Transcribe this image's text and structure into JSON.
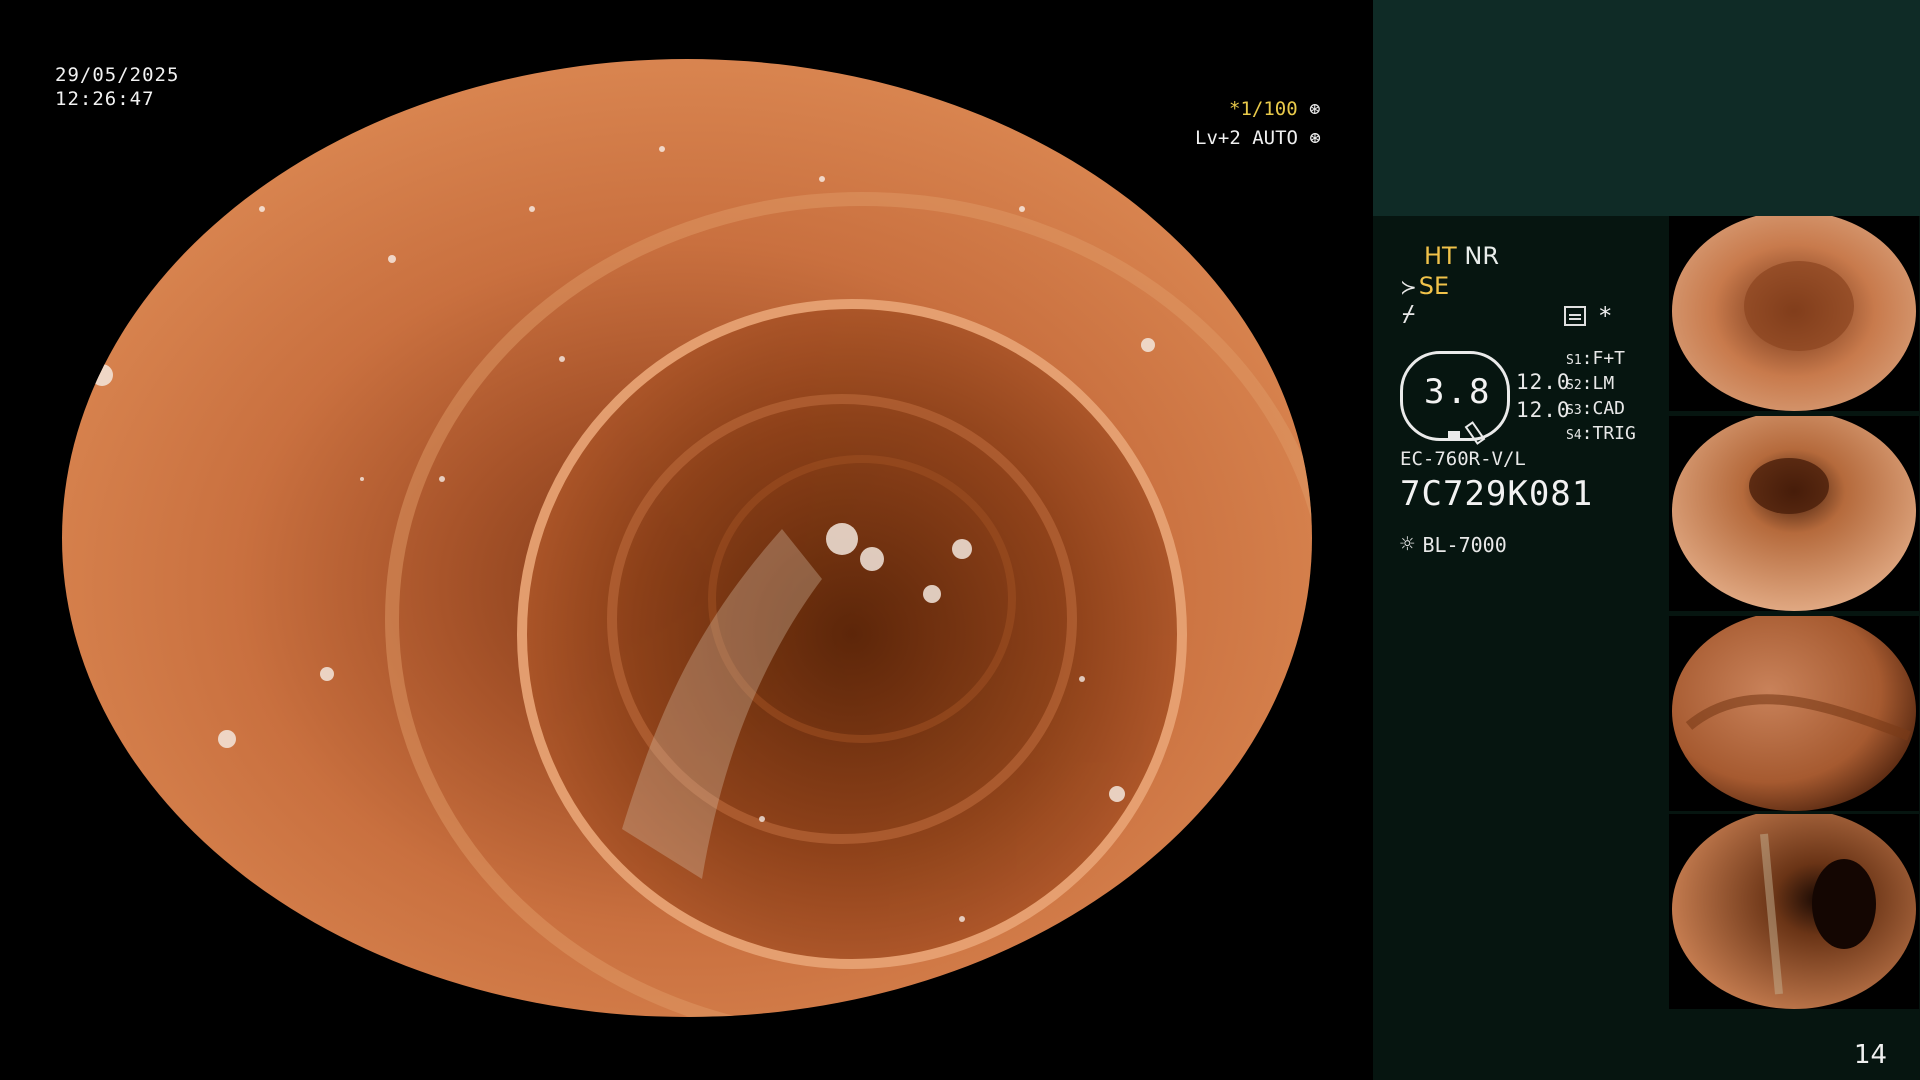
{
  "overlay": {
    "date": "29/05/2025",
    "time": "12:26:47",
    "shutter": "*1/100",
    "shutter_icon": "aperture-icon",
    "agc": "Lv+2 AUTO",
    "agc_icon": "iris-icon"
  },
  "panel": {
    "ht_label": "HT",
    "nr_label": "NR",
    "se_label": "SE",
    "enhance_icon": "enhancement-icon",
    "picture_icon": "picture-mode-icon",
    "star": "*",
    "gauge_value": "3.8",
    "value_1": "12.0",
    "value_2": "12.0",
    "switches": [
      {
        "key": "S1",
        "label": "F+T"
      },
      {
        "key": "S2",
        "label": "LM"
      },
      {
        "key": "S3",
        "label": "CAD"
      },
      {
        "key": "S4",
        "label": "TRIG"
      }
    ],
    "scope_model": "EC-760R-V/L",
    "serial": "7C729K081",
    "light_source": "BL-7000",
    "light_icon": "light-source-icon"
  },
  "thumbnails": [
    {
      "name": "thumbnail-1"
    },
    {
      "name": "thumbnail-2"
    },
    {
      "name": "thumbnail-3"
    },
    {
      "name": "thumbnail-4"
    }
  ],
  "page_number": "14",
  "colors": {
    "highlight": "#f0c24a",
    "panel_bg": "#061510",
    "panel_top_bg": "#0f2b26",
    "mucosa": "#c8693a"
  }
}
